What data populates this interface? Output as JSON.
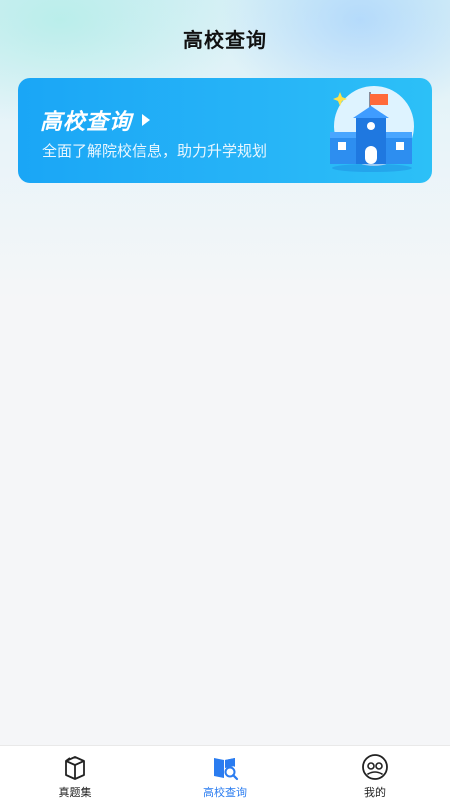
{
  "header": {
    "title": "高校查询"
  },
  "banner": {
    "title": "高校查询",
    "subtitle": "全面了解院校信息，助力升学规划",
    "illustration": "school-building-illustration"
  },
  "tabbar": {
    "tabs": [
      {
        "label": "真题集",
        "icon": "box-book-icon",
        "active": false
      },
      {
        "label": "高校查询",
        "icon": "school-search-icon",
        "active": true
      },
      {
        "label": "我的",
        "icon": "profile-icon",
        "active": false
      }
    ],
    "active_color": "#2a7cf0"
  },
  "colors": {
    "banner_gradient_start": "#1aa6f6",
    "banner_gradient_end": "#2cc0f7",
    "background": "#f5f6f8"
  }
}
